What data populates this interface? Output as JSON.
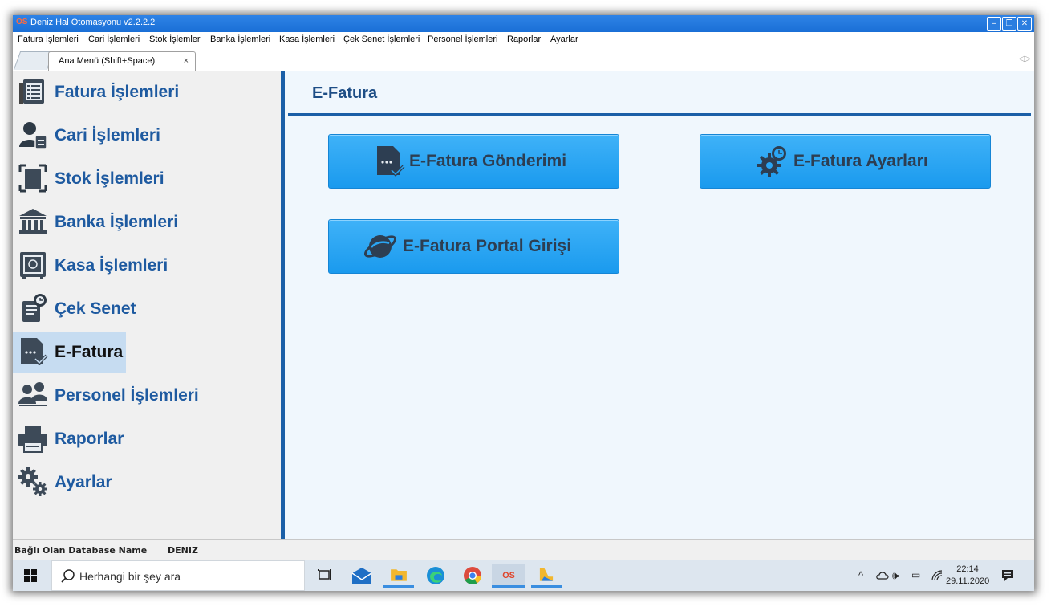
{
  "window": {
    "title": "Deniz Hal Otomasyonu v2.2.2.2",
    "app_icon_text": "OS"
  },
  "menu": [
    "Fatura İşlemleri",
    "Cari İşlemleri",
    "Stok İşlemler",
    "Banka İşlemleri",
    "Kasa İşlemleri",
    "Çek Senet İşlemleri",
    "Personel İşlemleri",
    "Raporlar",
    "Ayarlar"
  ],
  "tab": {
    "label": "Ana Menü (Shift+Space)",
    "close": "×"
  },
  "sidebar": {
    "items": [
      {
        "label": "Fatura İşlemleri",
        "icon": "invoice-list-icon"
      },
      {
        "label": "Cari İşlemleri",
        "icon": "user-account-icon"
      },
      {
        "label": "Stok İşlemleri",
        "icon": "stock-box-icon"
      },
      {
        "label": "Banka İşlemleri",
        "icon": "bank-icon"
      },
      {
        "label": "Kasa İşlemleri",
        "icon": "safe-icon"
      },
      {
        "label": "Çek Senet",
        "icon": "cheque-icon"
      },
      {
        "label": "E-Fatura",
        "icon": "e-invoice-icon",
        "selected": true
      },
      {
        "label": "Personel İşlemleri",
        "icon": "staff-icon"
      },
      {
        "label": "Raporlar",
        "icon": "printer-icon"
      },
      {
        "label": "Ayarlar",
        "icon": "gears-icon"
      }
    ]
  },
  "content": {
    "title": "E-Fatura",
    "buttons": [
      {
        "label": "E-Fatura Gönderimi",
        "icon": "send-invoice-icon"
      },
      {
        "label": "E-Fatura Ayarları",
        "icon": "settings-clock-icon"
      },
      {
        "label": "E-Fatura Portal Girişi",
        "icon": "portal-globe-icon"
      }
    ]
  },
  "status": {
    "key": "Bağlı Olan Database Name",
    "value": "DENIZ"
  },
  "taskbar": {
    "search_placeholder": "Herhangi bir şey ara",
    "time": "22:14",
    "date": "29.11.2020",
    "accent": "#3a8ee0"
  },
  "colors": {
    "accent_blue": "#1b5fa7",
    "sidebar_text": "#1e5aa0",
    "button_blue": "#2aa6f4"
  }
}
